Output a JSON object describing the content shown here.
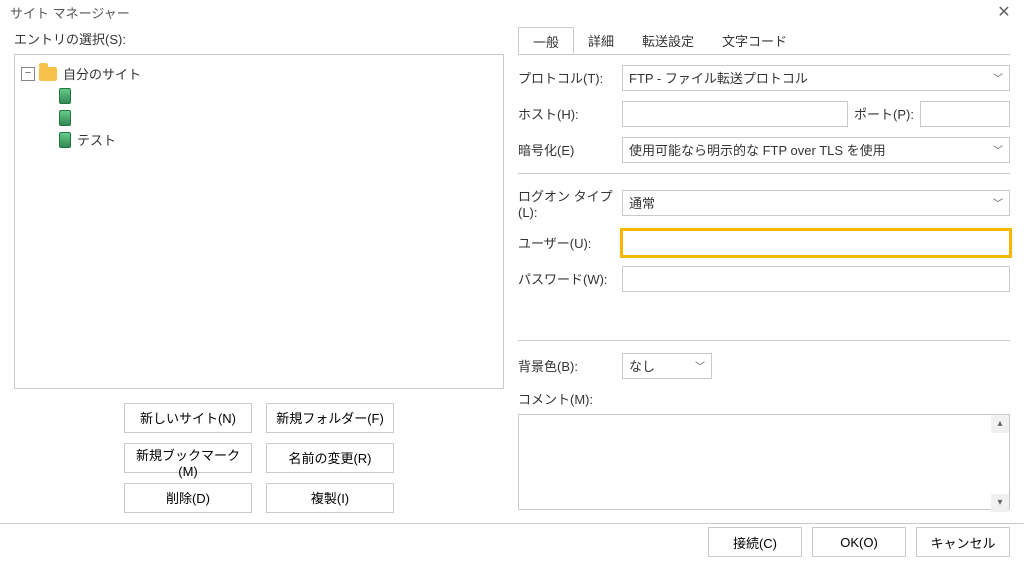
{
  "window": {
    "title": "サイト マネージャー"
  },
  "left": {
    "label": "エントリの選択(S):",
    "tree": {
      "root": {
        "label": "自分のサイト",
        "expanded": true
      },
      "children": [
        {
          "label": ""
        },
        {
          "label": ""
        },
        {
          "label": "テスト"
        }
      ]
    },
    "buttons": {
      "new_site": "新しいサイト(N)",
      "new_folder": "新規フォルダー(F)",
      "new_bookmark": "新規ブックマーク(M)",
      "rename": "名前の変更(R)",
      "delete": "削除(D)",
      "duplicate": "複製(I)"
    }
  },
  "tabs": {
    "general": "一般",
    "advanced": "詳細",
    "transfer": "転送設定",
    "charset": "文字コード",
    "active": "general"
  },
  "form": {
    "protocol": {
      "label": "プロトコル(T):",
      "value": "FTP - ファイル転送プロトコル"
    },
    "host": {
      "label": "ホスト(H):",
      "value": "",
      "port_label": "ポート(P):",
      "port_value": ""
    },
    "encryption": {
      "label": "暗号化(E)",
      "value": "使用可能なら明示的な FTP over TLS を使用"
    },
    "logon_type": {
      "label": "ログオン タイプ(L):",
      "value": "通常"
    },
    "user": {
      "label": "ユーザー(U):",
      "value": ""
    },
    "password": {
      "label": "パスワード(W):",
      "value": ""
    },
    "bgcolor": {
      "label": "背景色(B):",
      "value": "なし"
    },
    "comment": {
      "label": "コメント(M):",
      "value": ""
    }
  },
  "footer": {
    "connect": "接続(C)",
    "ok": "OK(O)",
    "cancel": "キャンセル"
  }
}
